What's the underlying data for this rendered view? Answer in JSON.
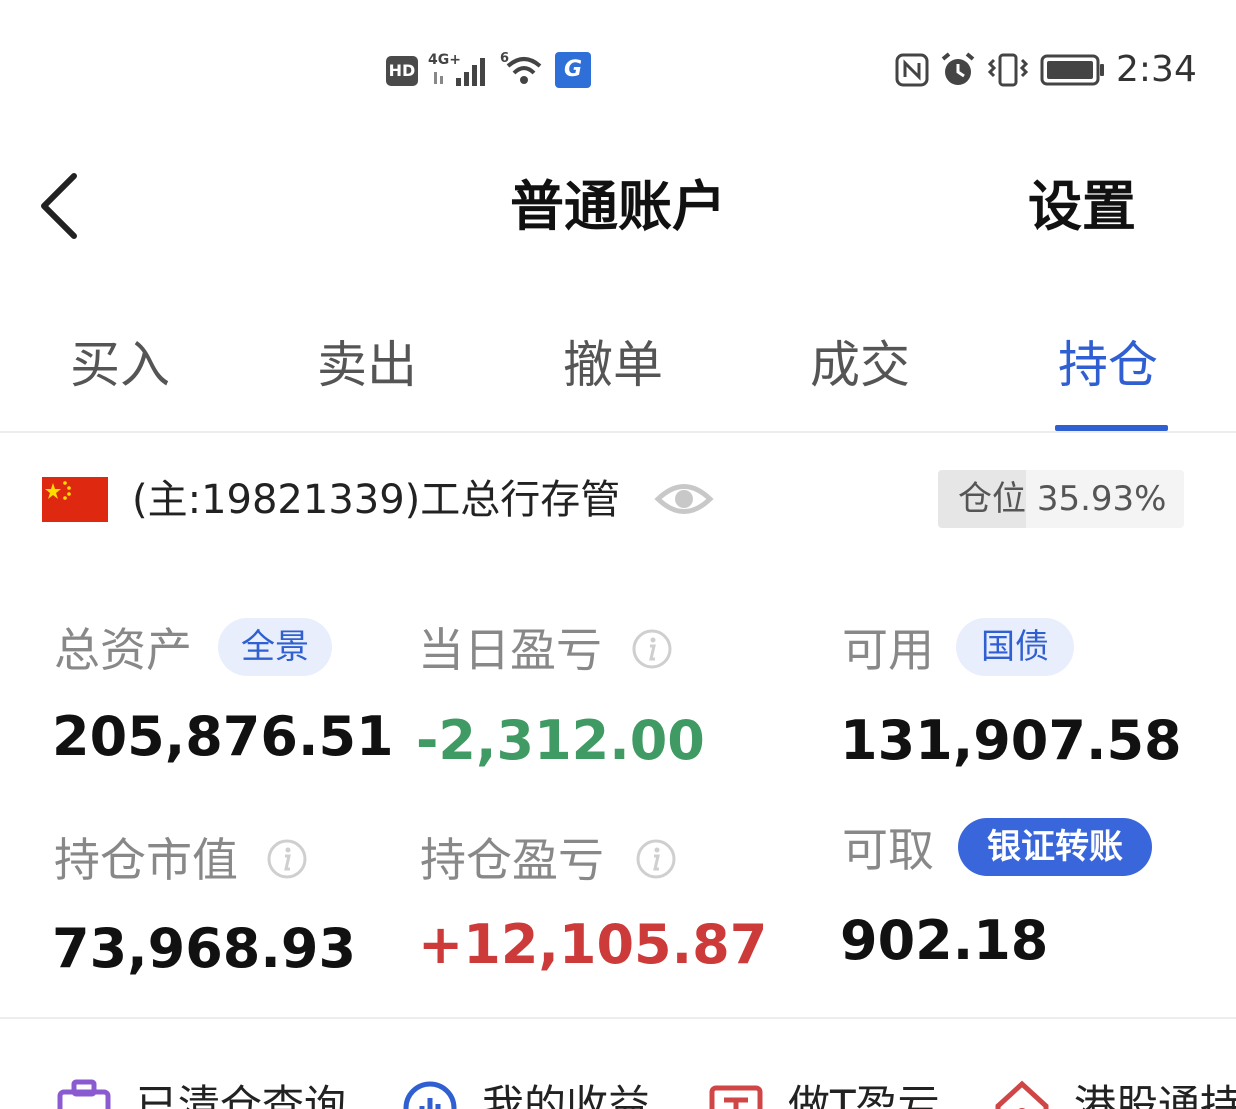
{
  "status_bar": {
    "hd": "HD",
    "network": "4G+",
    "wifi_gen": "6",
    "app_badge": "G",
    "time": "2:34",
    "icons": [
      "hd-icon",
      "signal-icon",
      "wifi-icon",
      "app-notification-icon",
      "nfc-icon",
      "alarm-icon",
      "vibrate-icon",
      "battery-icon"
    ]
  },
  "header": {
    "back_icon": "chevron-left-icon",
    "title": "普通账户",
    "settings_label": "设置"
  },
  "tabs": [
    {
      "label": "买入",
      "active": false
    },
    {
      "label": "卖出",
      "active": false
    },
    {
      "label": "撤单",
      "active": false
    },
    {
      "label": "成交",
      "active": false
    },
    {
      "label": "持仓",
      "active": true
    }
  ],
  "account": {
    "flag_icon": "china-flag-icon",
    "label": "(主:19821339)工总行存管",
    "visibility_icon": "eye-icon",
    "position_label": "仓位",
    "position_value": "35.93%",
    "position_ratio": 0.3593
  },
  "stats": {
    "total_assets": {
      "label": "总资产",
      "chip": "全景",
      "value": "205,876.51"
    },
    "daily_pnl": {
      "label": "当日盈亏",
      "value": "-2,312.00",
      "info_icon": "info-icon"
    },
    "available": {
      "label": "可用",
      "chip": "国债",
      "value": "131,907.58"
    },
    "market_value": {
      "label": "持仓市值",
      "value": "73,968.93",
      "info_icon": "info-icon"
    },
    "position_pnl": {
      "label": "持仓盈亏",
      "value": "+12,105.87",
      "info_icon": "info-icon"
    },
    "withdrawable": {
      "label": "可取",
      "chip": "银证转账",
      "value": "902.18"
    }
  },
  "colors": {
    "accent": "#2f5fd0",
    "negative": "#3f9a63",
    "positive": "#cc3a3a"
  },
  "shortcuts": [
    {
      "label": "已清仓查询",
      "icon": "cleared-positions-icon"
    },
    {
      "label": "我的收益",
      "icon": "earnings-chart-icon"
    },
    {
      "label": "做T盈亏",
      "icon": "t-trade-icon"
    },
    {
      "label": "港股通持",
      "icon": "hk-connect-icon"
    }
  ]
}
